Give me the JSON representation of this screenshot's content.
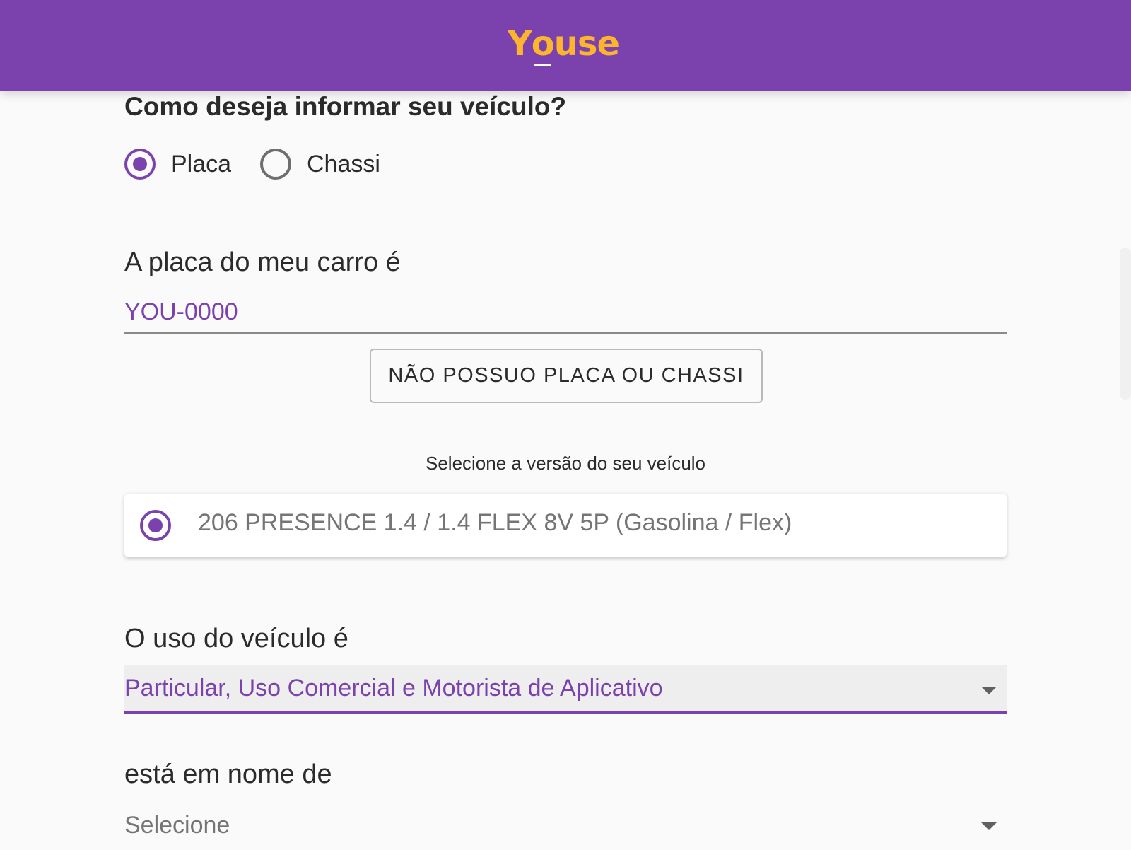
{
  "header": {
    "logo_text_pre": "Y",
    "logo_text_o": "o",
    "logo_text_post": "use",
    "background_color": "#7b42ad",
    "logo_color": "#fdb52d"
  },
  "vehicle_form": {
    "question": "Como deseja informar seu veículo?",
    "identify_options": [
      {
        "label": "Placa",
        "selected": true
      },
      {
        "label": "Chassi",
        "selected": false
      }
    ],
    "plate_label": "A placa do meu carro é",
    "plate_value": "YOU-0000",
    "no_plate_button": "NÃO POSSUO PLACA OU CHASSI",
    "version_hint": "Selecione a versão do seu veículo",
    "version_option": {
      "label": "206 PRESENCE 1.4 / 1.4 FLEX 8V 5P (Gasolina / Flex)",
      "selected": true
    },
    "usage_label": "O uso do veículo é",
    "usage_value": "Particular, Uso Comercial e Motorista de Aplicativo",
    "owner_label": "está em nome de",
    "owner_value": "Selecione"
  },
  "colors": {
    "accent": "#7b42ad",
    "text": "#2b2b2b",
    "muted": "#757575"
  }
}
